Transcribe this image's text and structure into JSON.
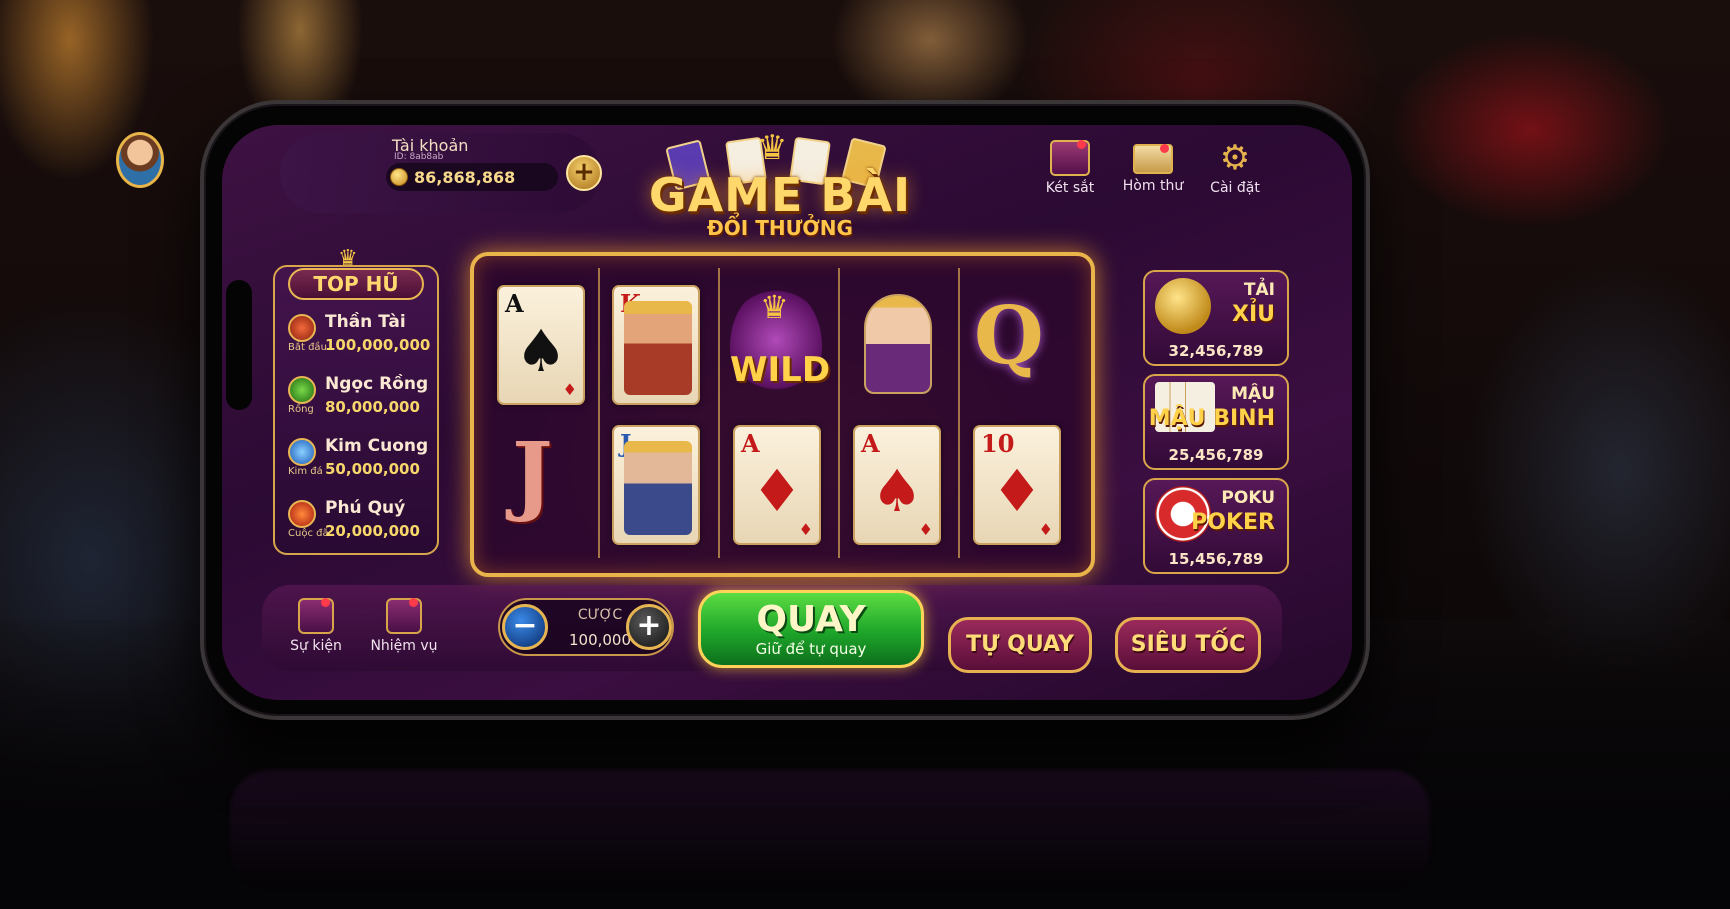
{
  "account": {
    "label": "Tài khoản",
    "sub": "ID: 8ab8ab",
    "balance": "86,868,868",
    "add_label": "+"
  },
  "logo": {
    "title": "GAME BÀI",
    "subtitle": "ĐỔI THƯỞNG"
  },
  "top_menu": [
    {
      "label": "Két sắt",
      "icon": "safe-icon"
    },
    {
      "label": "Hòm thư",
      "icon": "mail-icon"
    },
    {
      "label": "Cài đặt",
      "icon": "gear-icon"
    }
  ],
  "jackpot": {
    "title": "TOP HŨ",
    "items": [
      {
        "name": "Thần Tài",
        "tag": "Bắt đầu",
        "value": "100,000,000",
        "color": "#d84a2a"
      },
      {
        "name": "Ngọc Rồng",
        "tag": "Rồng",
        "value": "80,000,000",
        "color": "#3aa83a"
      },
      {
        "name": "Kim Cuong",
        "tag": "Kim đá",
        "value": "50,000,000",
        "color": "#3a8ae8"
      },
      {
        "name": "Phú Quý",
        "tag": "Cuộc đã",
        "value": "20,000,000",
        "color": "#e8502a"
      }
    ]
  },
  "reels": {
    "top": [
      {
        "rank": "A",
        "suit": "♠",
        "color": "blk",
        "kind": "card"
      },
      {
        "rank": "K",
        "suit": "♦",
        "color": "red",
        "kind": "face"
      },
      {
        "rank": "",
        "suit": "",
        "color": "",
        "kind": "wild",
        "text": "WILD"
      },
      {
        "rank": "",
        "suit": "",
        "color": "",
        "kind": "queen-sym"
      },
      {
        "rank": "Q",
        "suit": "",
        "color": "",
        "kind": "q-sym"
      }
    ],
    "bottom": [
      {
        "rank": "J",
        "suit": "",
        "color": "",
        "kind": "j-sym"
      },
      {
        "rank": "J",
        "suit": "♦",
        "color": "blk",
        "kind": "face"
      },
      {
        "rank": "A",
        "suit": "♦",
        "color": "red",
        "kind": "card"
      },
      {
        "rank": "A",
        "suit": "♠",
        "color": "red",
        "kind": "card"
      },
      {
        "rank": "10",
        "suit": "♦",
        "color": "red",
        "kind": "card"
      }
    ]
  },
  "games": [
    {
      "line1": "TẢI",
      "line2": "XỈU",
      "value": "32,456,789",
      "icon": "dice-icon"
    },
    {
      "line1": "MẬU",
      "line2": "MẬU BINH",
      "value": "25,456,789",
      "icon": "cards-icon"
    },
    {
      "line1": "POKU",
      "line2": "POKER",
      "value": "15,456,789",
      "icon": "poker-chip-icon"
    }
  ],
  "bottom": {
    "event_label": "Sự kiện",
    "mission_label": "Nhiệm vụ",
    "bet_label": "CƯỢC",
    "bet_value": "100,000",
    "minus": "−",
    "plus": "+",
    "spin_label": "QUAY",
    "spin_hint": "Giữ để tự quay",
    "auto_label": "TỰ QUAY",
    "turbo_label": "SIÊU TỐC"
  }
}
